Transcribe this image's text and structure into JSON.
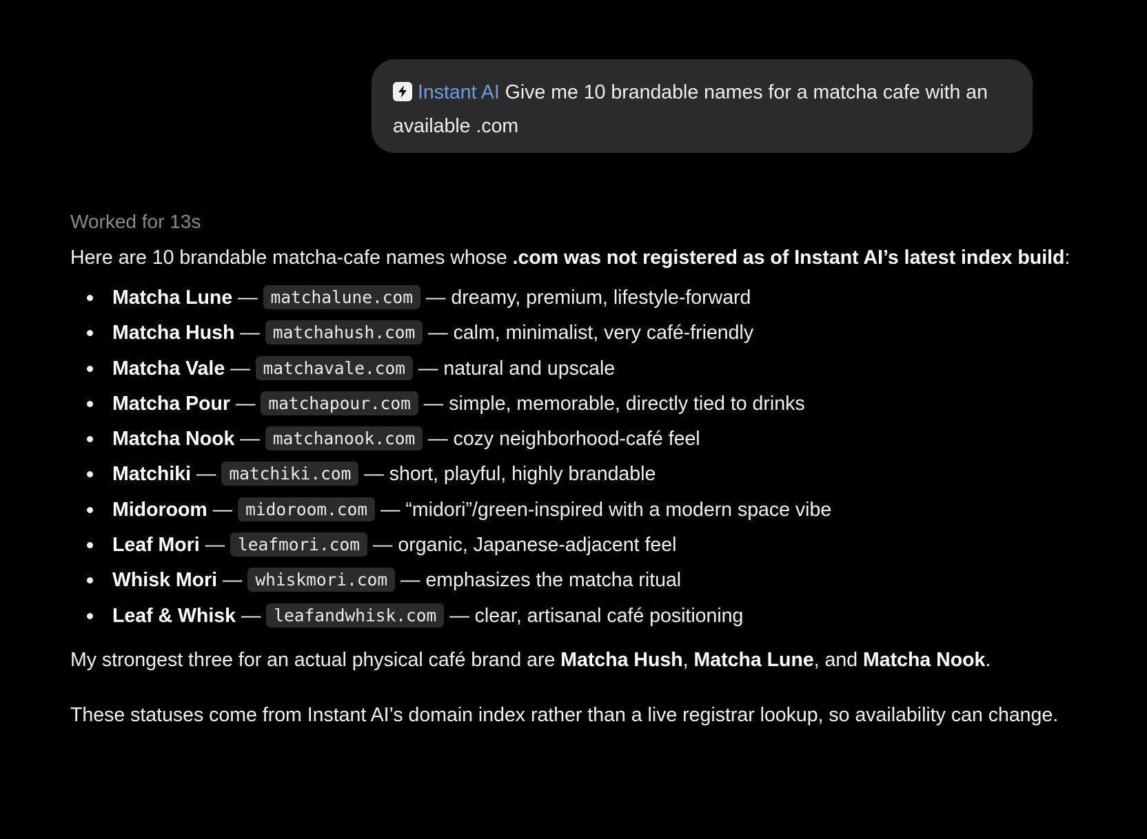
{
  "prompt": {
    "mention": "Instant AI",
    "text": " Give me 10 brandable names for a matcha cafe with an available .com",
    "icon": "bolt-icon"
  },
  "response": {
    "status": "Worked for 13s",
    "intro": {
      "lead": "Here are 10 brandable matcha-cafe names whose ",
      "bold": ".com was not registered as of Instant AI’s latest index build",
      "tail": ":"
    },
    "items": [
      {
        "name": "Matcha Lune",
        "sep1": " — ",
        "domain": "matchalune.com",
        "desc": " — dreamy, premium, lifestyle-forward"
      },
      {
        "name": "Matcha Hush",
        "sep1": " — ",
        "domain": "matchahush.com",
        "desc": " — calm, minimalist, very café-friendly"
      },
      {
        "name": "Matcha Vale",
        "sep1": " — ",
        "domain": "matchavale.com",
        "desc": " — natural and upscale"
      },
      {
        "name": "Matcha Pour",
        "sep1": " — ",
        "domain": "matchapour.com",
        "desc": " — simple, memorable, directly tied to drinks"
      },
      {
        "name": "Matcha Nook",
        "sep1": " — ",
        "domain": "matchanook.com",
        "desc": " — cozy neighborhood-café feel"
      },
      {
        "name": "Matchiki",
        "sep1": " — ",
        "domain": "matchiki.com",
        "desc": " — short, playful, highly brandable"
      },
      {
        "name": "Midoroom",
        "sep1": " — ",
        "domain": "midoroom.com",
        "desc": " — “midori”/green-inspired with a modern space vibe"
      },
      {
        "name": "Leaf Mori",
        "sep1": " — ",
        "domain": "leafmori.com",
        "desc": " — organic, Japanese-adjacent feel"
      },
      {
        "name": "Whisk Mori",
        "sep1": " — ",
        "domain": "whiskmori.com",
        "desc": " — emphasizes the matcha ritual"
      },
      {
        "name": "Leaf & Whisk",
        "sep1": " — ",
        "domain": "leafandwhisk.com",
        "desc": " — clear, artisanal café positioning"
      }
    ],
    "strongest": {
      "lead": "My strongest three for an actual physical café brand are ",
      "pick1": "Matcha Hush",
      "sep1": ", ",
      "pick2": "Matcha Lune",
      "sep2": ", and ",
      "pick3": "Matcha Nook",
      "tail": "."
    },
    "disclaimer": "These statuses come from Instant AI’s domain index rather than a live registrar lookup, so availability can change."
  },
  "colors": {
    "background": "#000000",
    "bubble": "#2b2b2b",
    "mention": "#6b9de3",
    "muted": "#8a8a8a",
    "code_bg": "#2b2b2b"
  }
}
